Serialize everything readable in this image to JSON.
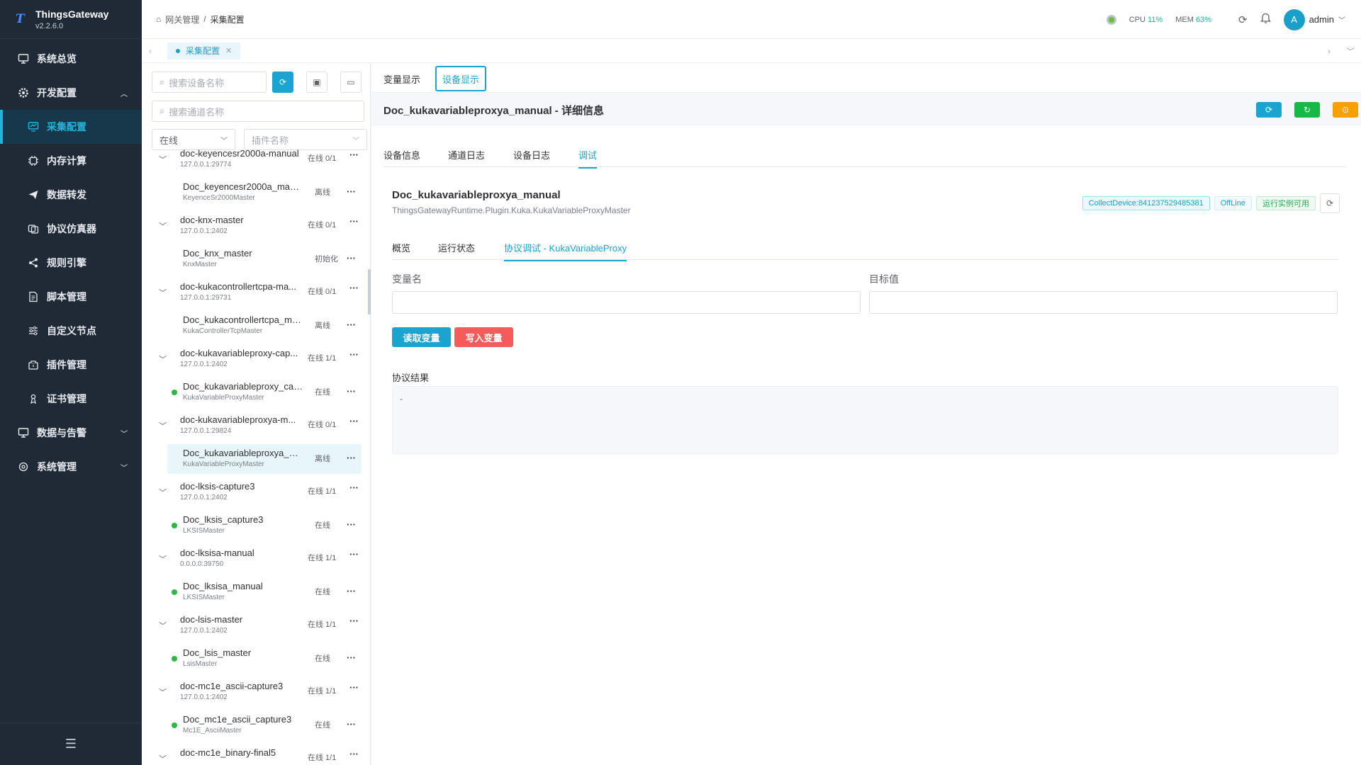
{
  "app": {
    "name": "ThingsGateway",
    "version": "v2.2.6.0"
  },
  "sidebar": {
    "items": [
      {
        "label": "系统总览",
        "icon": "dashboard-icon"
      },
      {
        "label": "开发配置",
        "icon": "gear-icon"
      },
      {
        "label": "采集配置",
        "icon": "collect-icon"
      },
      {
        "label": "内存计算",
        "icon": "chip-icon"
      },
      {
        "label": "数据转发",
        "icon": "send-icon"
      },
      {
        "label": "协议仿真器",
        "icon": "simulator-icon"
      },
      {
        "label": "规则引擎",
        "icon": "share-icon"
      },
      {
        "label": "脚本管理",
        "icon": "script-icon"
      },
      {
        "label": "自定义节点",
        "icon": "sliders-icon"
      },
      {
        "label": "插件管理",
        "icon": "plugin-icon"
      },
      {
        "label": "证书管理",
        "icon": "cert-icon"
      },
      {
        "label": "数据与告警",
        "icon": "monitor-icon"
      },
      {
        "label": "系统管理",
        "icon": "settings-icon"
      }
    ]
  },
  "header": {
    "breadcrumb": [
      "网关管理",
      "采集配置"
    ],
    "cpu_label": "CPU",
    "cpu_value": "11%",
    "mem_label": "MEM",
    "mem_value": "63%",
    "avatar_letter": "A",
    "username": "admin"
  },
  "page_tab": {
    "label": "采集配置"
  },
  "tree": {
    "search_device_placeholder": "搜索设备名称",
    "search_channel_placeholder": "搜索通道名称",
    "status_filter": "在线",
    "plugin_placeholder": "插件名称",
    "nodes": [
      {
        "channel": "doc-keyencesr2000a-manual",
        "ip": "127.0.0.1:29774",
        "count": "在线 0/1",
        "device": "Doc_keyencesr2000a_manual",
        "plugin": "KeyenceSr2000Master",
        "state": "离线",
        "online": false
      },
      {
        "channel": "doc-knx-master",
        "ip": "127.0.0.1:2402",
        "count": "在线 0/1",
        "device": "Doc_knx_master",
        "plugin": "KnxMaster",
        "state": "初始化",
        "online": false
      },
      {
        "channel": "doc-kukacontrollertcpa-ma...",
        "ip": "127.0.0.1:29731",
        "count": "在线 0/1",
        "device": "Doc_kukacontrollertcpa_man...",
        "plugin": "KukaControllerTcpMaster",
        "state": "离线",
        "online": false
      },
      {
        "channel": "doc-kukavariableproxy-cap...",
        "ip": "127.0.0.1:2402",
        "count": "在线 1/1",
        "device": "Doc_kukavariableproxy_capt...",
        "plugin": "KukaVariableProxyMaster",
        "state": "在线",
        "online": true
      },
      {
        "channel": "doc-kukavariableproxya-m...",
        "ip": "127.0.0.1:29824",
        "count": "在线 0/1",
        "device": "Doc_kukavariableproxya_ma...",
        "plugin": "KukaVariableProxyMaster",
        "state": "离线",
        "online": false
      },
      {
        "channel": "doc-lksis-capture3",
        "ip": "127.0.0.1:2402",
        "count": "在线 1/1",
        "device": "Doc_lksis_capture3",
        "plugin": "LKSISMaster",
        "state": "在线",
        "online": true
      },
      {
        "channel": "doc-lksisa-manual",
        "ip": "0.0.0.0:39750",
        "count": "在线 1/1",
        "device": "Doc_lksisa_manual",
        "plugin": "LKSISMaster",
        "state": "在线",
        "online": true
      },
      {
        "channel": "doc-lsis-master",
        "ip": "127.0.0.1:2402",
        "count": "在线 1/1",
        "device": "Doc_lsis_master",
        "plugin": "LsisMaster",
        "state": "在线",
        "online": true
      },
      {
        "channel": "doc-mc1e_ascii-capture3",
        "ip": "127.0.0.1:2402",
        "count": "在线 1/1",
        "device": "Doc_mc1e_ascii_capture3",
        "plugin": "Mc1E_AsciiMaster",
        "state": "在线",
        "online": true
      },
      {
        "channel": "doc-mc1e_binary-final5",
        "ip": "",
        "count": "在线 1/1",
        "device": "",
        "plugin": "",
        "state": "",
        "online": true
      }
    ]
  },
  "main": {
    "view_tabs": [
      "变量显示",
      "设备显示"
    ],
    "title": "Doc_kukavariableproxya_manual - 详细信息",
    "detail_tabs": [
      "设备信息",
      "通道日志",
      "设备日志",
      "调试"
    ],
    "device_name": "Doc_kukavariableproxya_manual",
    "plugin_path": "ThingsGatewayRuntime.Plugin.Kuka.KukaVariableProxyMaster",
    "tags": [
      "CollectDevice:841237529485381",
      "OffLine",
      "运行实例可用"
    ],
    "inner_tabs": [
      "概览",
      "运行状态",
      "协议调试 - KukaVariableProxy"
    ],
    "variable_label": "变量名",
    "target_label": "目标值",
    "read_button": "读取变量",
    "write_button": "写入变量",
    "result_label": "协议结果",
    "result_value": "-"
  },
  "colors": {
    "accent": "#1ba4d0",
    "sidebar": "#1f2a36",
    "danger": "#f45b5b",
    "success": "#17b845",
    "warning": "#f7a100"
  }
}
